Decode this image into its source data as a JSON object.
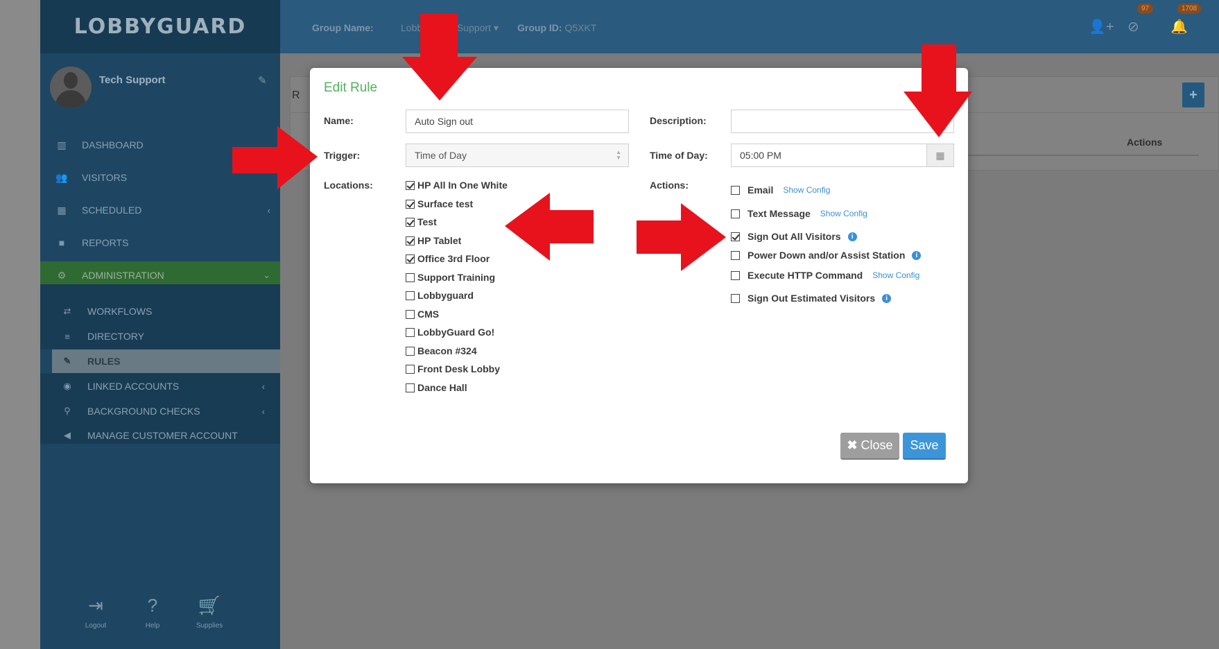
{
  "brand": {
    "name": "LOBBYGUARD"
  },
  "profile": {
    "name": "Tech Support"
  },
  "header": {
    "group_name_label": "Group Name:",
    "group_name_value": "LobbyGuard Support",
    "group_id_label": "Group ID:",
    "group_id_value": "Q5XKT",
    "badge_1": "97",
    "badge_2": "1708"
  },
  "sidebar": {
    "items": [
      {
        "label": "DASHBOARD"
      },
      {
        "label": "VISITORS"
      },
      {
        "label": "SCHEDULED"
      },
      {
        "label": "REPORTS"
      },
      {
        "label": "ADMINISTRATION"
      }
    ],
    "subitems": [
      {
        "label": "WORKFLOWS"
      },
      {
        "label": "DIRECTORY"
      },
      {
        "label": "RULES"
      },
      {
        "label": "LINKED ACCOUNTS"
      },
      {
        "label": "BACKGROUND CHECKS"
      },
      {
        "label": "MANAGE CUSTOMER ACCOUNT"
      }
    ],
    "bottom": [
      {
        "label": "Logout"
      },
      {
        "label": "Help"
      },
      {
        "label": "Supplies"
      }
    ]
  },
  "page": {
    "actions_column": "Actions",
    "panel_initial": "R",
    "add_label": "+"
  },
  "modal": {
    "title": "Edit Rule",
    "name_label": "Name:",
    "name_value": "Auto Sign out",
    "description_label": "Description:",
    "description_value": "",
    "trigger_label": "Trigger:",
    "trigger_value": "Time of Day",
    "time_label": "Time of Day:",
    "time_value": "05:00 PM",
    "locations_label": "Locations:",
    "actions_label": "Actions:",
    "locations": [
      {
        "label": "HP All In One White",
        "checked": true
      },
      {
        "label": "Surface test",
        "checked": true
      },
      {
        "label": "Test",
        "checked": true
      },
      {
        "label": "HP Tablet",
        "checked": true
      },
      {
        "label": "Office 3rd Floor",
        "checked": true
      },
      {
        "label": "Support Training",
        "checked": false
      },
      {
        "label": "Lobbyguard",
        "checked": false
      },
      {
        "label": "CMS",
        "checked": false
      },
      {
        "label": "LobbyGuard Go!",
        "checked": false
      },
      {
        "label": "Beacon #324",
        "checked": false
      },
      {
        "label": "Front Desk Lobby",
        "checked": false
      },
      {
        "label": "Dance Hall",
        "checked": false
      }
    ],
    "actions": [
      {
        "label": "Email",
        "checked": false,
        "config": "Show Config"
      },
      {
        "label": "Text Message",
        "checked": false,
        "config": "Show Config"
      },
      {
        "label": "Sign Out All Visitors",
        "checked": true,
        "info": "i"
      },
      {
        "label": "Power Down and/or Assist Station",
        "checked": false,
        "info": "i"
      },
      {
        "label": "Execute HTTP Command",
        "checked": false,
        "config": "Show Config"
      },
      {
        "label": "Sign Out Estimated Visitors",
        "checked": false,
        "info": "i"
      }
    ],
    "close_label": "Close",
    "save_label": "Save"
  },
  "colors": {
    "accent_green": "#55b05d",
    "save_blue": "#3d95d9",
    "annotation_red": "#e8121c"
  }
}
